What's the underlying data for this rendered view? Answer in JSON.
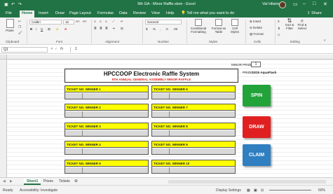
{
  "titlebar": {
    "title": "9th GA - Minor Raffle.xlsm - Excel",
    "user": "Val Hilario",
    "qa_icons": [
      "save-icon",
      "undo-icon",
      "redo-icon"
    ]
  },
  "ribbon_tabs": [
    "File",
    "Home",
    "Insert",
    "Draw",
    "Page Layout",
    "Formulas",
    "Data",
    "Review",
    "View",
    "Help"
  ],
  "tell_me": "Tell me what you want to do",
  "share": "Share",
  "ribbon": {
    "paste": "Paste",
    "font_name": "Calibri",
    "font_size": "16",
    "number_format": "General",
    "groups": [
      "Clipboard",
      "Font",
      "Alignment",
      "Number",
      "Styles",
      "Cells",
      "Editing"
    ],
    "conditional_formatting": "Conditional Formatting",
    "format_as_table": "Format as Table",
    "cell_styles": "Cell Styles",
    "insert": "Insert",
    "delete": "Delete",
    "format": "Format",
    "sort_filter": "Sort & Filter",
    "find_select": "Find & Select"
  },
  "formula_bar": {
    "name_box": "Q1",
    "fx": "fx",
    "value": "1"
  },
  "sheet": {
    "banner_title": "HPCCOOP Electronic Raffle System",
    "banner_subtitle": "9TH ANNUAL GENERAL ASSEMBLY MINOR RAFFLE",
    "minor_prize_label": "MINOR PRIZE NO:",
    "minor_prize_value": "1",
    "prize_label": "PRIZE:",
    "prize_value": "32Gb AquaFlash",
    "winners_left": [
      "TICKET NO.  WINNER 1",
      "TICKET NO.  WINNER 2",
      "TICKET NO.  WINNER 3",
      "TICKET NO.  WINNER 4",
      "TICKET NO.  WINNER 5"
    ],
    "winners_right": [
      "TICKET NO.  WINNER 6",
      "TICKET NO.  WINNER 7",
      "TICKET NO.  WINNER 8",
      "TICKET NO.  WINNER 9",
      "TICKET NO.  WINNER 10"
    ],
    "buttons": {
      "spin": "SPIN",
      "draw": "DRAW",
      "claim": "CLAIM"
    },
    "colors": {
      "spin": "#21a33a",
      "draw": "#e02020",
      "claim": "#2f7fc1",
      "yellow": "#ffff00"
    }
  },
  "sheet_tabs": [
    "Sheet1",
    "Prizes",
    "Tickets"
  ],
  "status": {
    "ready": "Ready",
    "accessibility": "Accessibility: Investigate",
    "display_settings": "Display Settings",
    "zoom": "60%"
  }
}
